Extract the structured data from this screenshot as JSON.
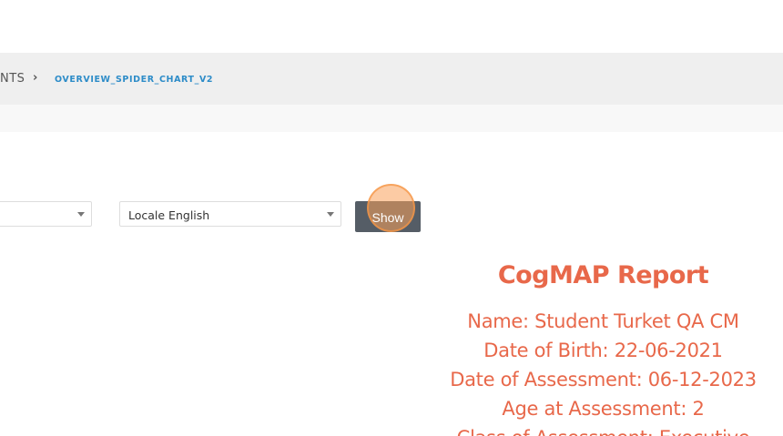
{
  "breadcrumb": {
    "previous": "NTS",
    "separator": "›",
    "current": "OVERVIEW_SPIDER_CHART_V2"
  },
  "filters": {
    "left_select_value": "",
    "locale_select_value": "Locale English",
    "show_label": "Show"
  },
  "report": {
    "title": "CogMAP Report",
    "lines": [
      "Name: Student Turket QA CM",
      "Date of Birth: 22-06-2021",
      "Date of Assessment: 06-12-2023",
      "Age at Assessment: 2",
      "Class of Assessment: Executive"
    ]
  },
  "colors": {
    "accent_report": "#e8684a",
    "breadcrumb_link": "#2d8cc8",
    "button_bg": "#555d66"
  }
}
